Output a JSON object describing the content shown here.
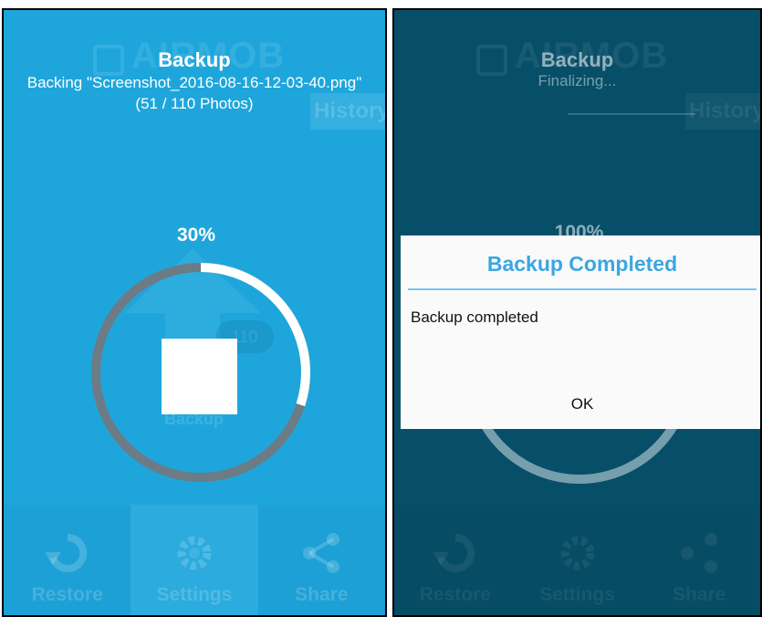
{
  "left": {
    "title": "Backup",
    "subtitle_line1": "Backing \"Screenshot_2016-08-16-12-03-40.png\"",
    "subtitle_line2": "(51 / 110 Photos)",
    "progress_label": "30%",
    "progress": 0.3,
    "bg_logo": "AIRMOB",
    "bg_history": "History",
    "bg_badge": "110",
    "bg_backup_label": "Backup",
    "bottom_nav": [
      {
        "label": "Restore",
        "icon": "restore-icon"
      },
      {
        "label": "Settings",
        "icon": "gear-icon"
      },
      {
        "label": "Share",
        "icon": "share-icon"
      }
    ]
  },
  "right": {
    "title": "Backup",
    "subtitle": "Finalizing...",
    "progress_label": "100%",
    "bg_logo": "AIRMOB",
    "bg_history": "History",
    "bottom_nav": [
      {
        "label": "Restore",
        "icon": "restore-icon"
      },
      {
        "label": "Settings",
        "icon": "gear-icon"
      },
      {
        "label": "Share",
        "icon": "share-icon"
      }
    ],
    "dialog": {
      "title": "Backup Completed",
      "message": "Backup completed",
      "ok_label": "OK"
    }
  },
  "colors": {
    "left_bg": "#1ea6dc",
    "right_bg": "#074f68",
    "ring_track": "#6b7c86",
    "ring_fill": "#ffffff",
    "dialog_title": "#3aa7e0",
    "dialog_divider": "#74c6ee"
  }
}
